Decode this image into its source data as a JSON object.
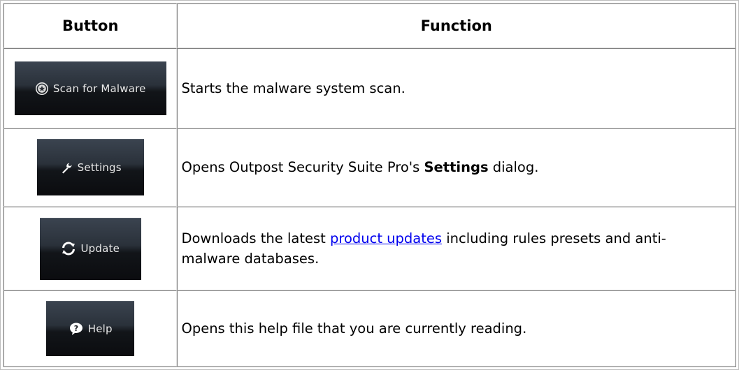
{
  "header": {
    "button_col": "Button",
    "function_col": "Function"
  },
  "rows": [
    {
      "button_label": "Scan for Malware",
      "icon": "shield-star-icon",
      "description": "Starts the malware system scan."
    },
    {
      "button_label": "Settings",
      "icon": "wrench-icon",
      "description_before": "Opens Outpost Security Suite Pro's ",
      "description_bold": "Settings",
      "description_after": " dialog."
    },
    {
      "button_label": "Update",
      "icon": "refresh-icon",
      "description_before": "Downloads the latest ",
      "description_link": "product updates",
      "description_after": " including rules presets and anti-malware databases."
    },
    {
      "button_label": "Help",
      "icon": "question-icon",
      "description": "Opens this help file that you are currently reading."
    }
  ],
  "colors": {
    "link": "#0000ee",
    "button_top": "#3b4450",
    "button_bottom": "#0b0c0f",
    "button_text": "#e8e8e8",
    "border_dark": "#808080"
  }
}
